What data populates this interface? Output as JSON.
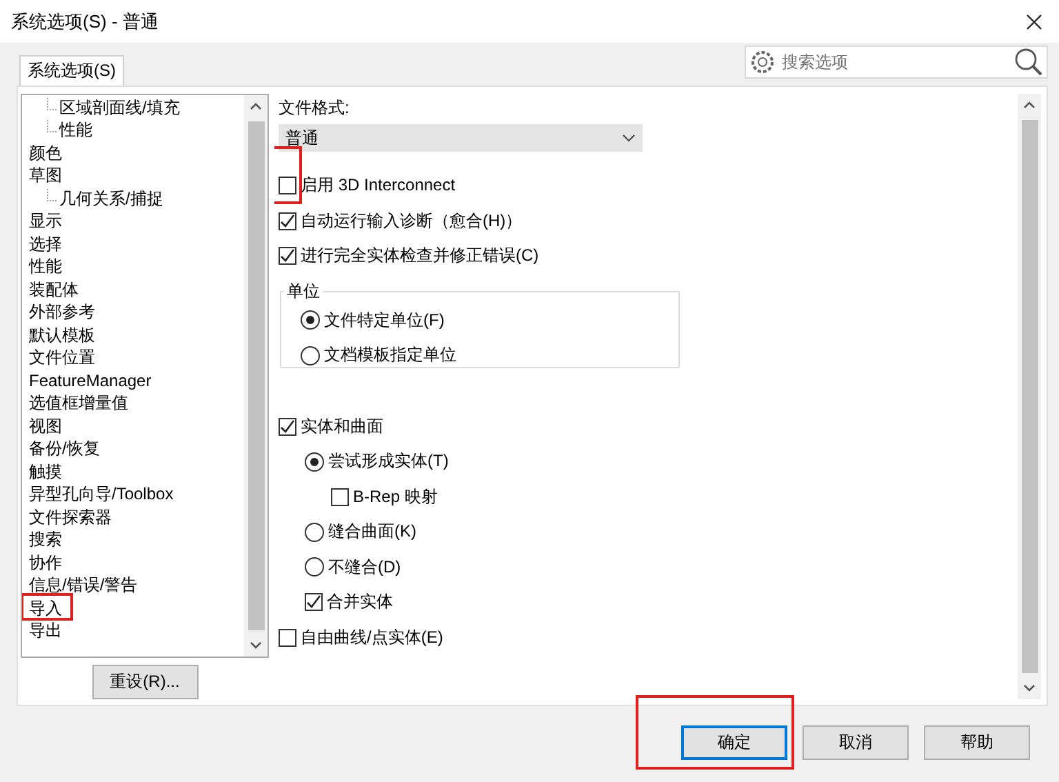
{
  "window": {
    "title": "系统选项(S) - 普通"
  },
  "tabs": [
    {
      "label": "系统选项(S)",
      "selected": true
    }
  ],
  "search": {
    "placeholder": "搜索选项"
  },
  "tree": {
    "items": [
      {
        "children": [
          {
            "label": "区域剖面线/填充",
            "highlighted": false
          },
          {
            "label": "性能",
            "highlighted": false
          }
        ]
      },
      {
        "label": "颜色",
        "highlighted": false
      },
      {
        "label": "草图",
        "highlighted": false,
        "children": [
          {
            "label": "几何关系/捕捉",
            "highlighted": false
          }
        ]
      },
      {
        "label": "显示",
        "highlighted": false
      },
      {
        "label": "选择",
        "highlighted": false
      },
      {
        "label": "性能",
        "highlighted": false
      },
      {
        "label": "装配体",
        "highlighted": false
      },
      {
        "label": "外部参考",
        "highlighted": false
      },
      {
        "label": "默认模板",
        "highlighted": false
      },
      {
        "label": "文件位置",
        "highlighted": false
      },
      {
        "label": "FeatureManager",
        "highlighted": false
      },
      {
        "label": "选值框增量值",
        "highlighted": false
      },
      {
        "label": "视图",
        "highlighted": false
      },
      {
        "label": "备份/恢复",
        "highlighted": false
      },
      {
        "label": "触摸",
        "highlighted": false
      },
      {
        "label": "异型孔向导/Toolbox",
        "highlighted": false
      },
      {
        "label": "文件探索器",
        "highlighted": false
      },
      {
        "label": "搜索",
        "highlighted": false
      },
      {
        "label": "协作",
        "highlighted": false
      },
      {
        "label": "信息/错误/警告",
        "highlighted": false
      },
      {
        "label": "导入",
        "highlighted": true
      },
      {
        "label": "导出",
        "highlighted": false
      }
    ]
  },
  "reset_button": {
    "label": "重设(R)..."
  },
  "file_format": {
    "label": "文件格式:",
    "value": "普通"
  },
  "options": [
    {
      "kind": "checkbox",
      "label": "启用 3D Interconnect",
      "checked": false,
      "highlighted": true
    },
    {
      "kind": "checkbox",
      "label": "自动运行输入诊断（愈合(H)）",
      "checked": true,
      "highlighted": false
    },
    {
      "kind": "checkbox",
      "label": "进行完全实体检查并修正错误(C)",
      "checked": true,
      "highlighted": false
    },
    {
      "kind": "group",
      "label": "单位",
      "children": [
        {
          "kind": "radio",
          "label": "文件特定单位(F)",
          "selected": true
        },
        {
          "kind": "radio",
          "label": "文档模板指定单位",
          "selected": false
        }
      ]
    },
    {
      "kind": "checkbox",
      "label": "实体和曲面",
      "checked": true,
      "highlighted": false,
      "children": [
        {
          "kind": "radio",
          "label": "尝试形成实体(T)",
          "selected": true,
          "children": [
            {
              "kind": "checkbox",
              "label": "B-Rep 映射",
              "checked": false,
              "highlighted": false
            }
          ]
        },
        {
          "kind": "radio",
          "label": "缝合曲面(K)",
          "selected": false
        },
        {
          "kind": "radio",
          "label": "不缝合(D)",
          "selected": false
        },
        {
          "kind": "checkbox",
          "label": "合并实体",
          "checked": true,
          "highlighted": false
        }
      ]
    },
    {
      "kind": "checkbox",
      "label": "自由曲线/点实体(E)",
      "checked": false,
      "highlighted": false
    }
  ],
  "buttons": [
    {
      "label": "确定",
      "highlighted": true
    },
    {
      "label": "取消",
      "highlighted": false
    },
    {
      "label": "帮助",
      "highlighted": false
    }
  ]
}
